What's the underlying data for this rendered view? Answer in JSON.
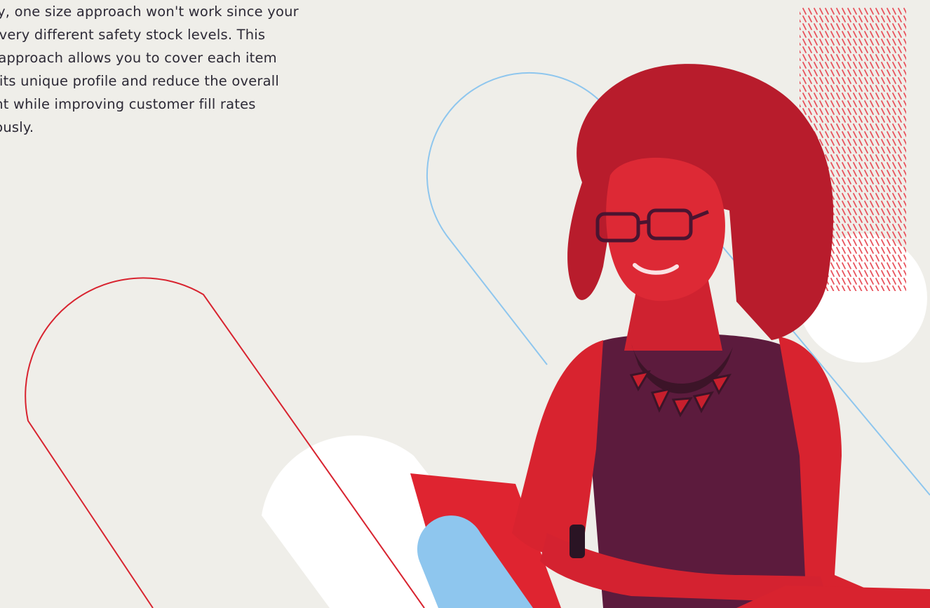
{
  "body_text": {
    "lines": [
      "try, one size approach won't work since your",
      "e very different safety stock levels. This",
      "c approach allows you to cover each item",
      "h its unique profile and reduce the overall",
      "ent while improving customer fill rates",
      "eously."
    ]
  },
  "colors": {
    "background": "#efeee9",
    "text": "#2d2a36",
    "brand_red": "#d8232f",
    "light_blue": "#8ec6ee",
    "white": "#ffffff",
    "plum": "#5a1a3c"
  },
  "photo": {
    "subject": "woman-with-glasses-at-laptop"
  }
}
